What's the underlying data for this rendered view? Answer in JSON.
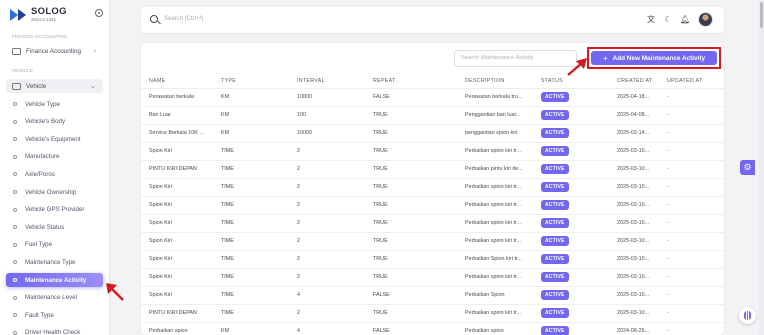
{
  "brand": {
    "name": "SOLOG",
    "version": "2024.8.1441"
  },
  "sidebar": {
    "section_top": "FINANCE ACCOUNTING",
    "finance": "Finance Accounting",
    "section_vehicle": "VEHICLE",
    "vehicle": "Vehicle",
    "items": [
      "Vehicle Type",
      "Vehicle's Body",
      "Vehicle's Equipment",
      "Manufacture",
      "Axle/Poros",
      "Vehicle Ownership",
      "Vehicle GPS Provider",
      "Vehicle Status",
      "Fuel Type",
      "Maintenance Type",
      "Maintenance Activity",
      "Maintenance Level",
      "Fault Type",
      "Driver Health Check"
    ],
    "active_index": 10
  },
  "topbar": {
    "search_placeholder": "Search (Ctrl+/)"
  },
  "toolbar": {
    "search_placeholder": "Search Maintenance Activity",
    "add_label": "Add New Maintenance Activity",
    "add_plus": "+"
  },
  "table": {
    "columns": [
      "NAME",
      "TYPE",
      "INTERVAL",
      "REPEAT",
      "DESCRIPTION",
      "STATUS",
      "CREATED AT",
      "UPDATED AT"
    ],
    "rows": [
      [
        "Perawatan berkala",
        "KM",
        "10000",
        "FALSE",
        "Perawatan berkala tru...",
        "ACTIVE",
        "2025-04-18...",
        "-"
      ],
      [
        "Ban Luar",
        "KM",
        "100",
        "TRUE",
        "Penggantian ban luar...",
        "ACTIVE",
        "2025-04-08...",
        "-"
      ],
      [
        "Service Berkala 10K ...",
        "KM",
        "10000",
        "TRUE",
        "penggantian spion kiri",
        "ACTIVE",
        "2025-03-14...",
        "-"
      ],
      [
        "Spion Kiri",
        "TIME",
        "2",
        "TRUE",
        "Perbaikan spion kiri tr...",
        "ACTIVE",
        "2025-03-10...",
        "-"
      ],
      [
        "PINTU KIRI DEPAN",
        "TIME",
        "2",
        "TRUE",
        "Perbaikan pintu kiri de...",
        "ACTIVE",
        "2025-03-10...",
        "-"
      ],
      [
        "Spion Kiri",
        "TIME",
        "2",
        "TRUE",
        "Perbaikan spion kiri tr...",
        "ACTIVE",
        "2025-03-10...",
        "-"
      ],
      [
        "Spion Kiri",
        "TIME",
        "2",
        "TRUE",
        "Perbaikan spion kiri tr...",
        "ACTIVE",
        "2025-03-10...",
        "-"
      ],
      [
        "Spion Kiri",
        "TIME",
        "2",
        "TRUE",
        "Perbaikan spion kiri tr...",
        "ACTIVE",
        "2025-03-10...",
        "-"
      ],
      [
        "Spion Kiri",
        "TIME",
        "2",
        "TRUE",
        "Perbaikan spion kiri tr...",
        "ACTIVE",
        "2025-03-10...",
        "-"
      ],
      [
        "Spion Kiri",
        "TIME",
        "2",
        "TRUE",
        "Perbaikan Spion kiri tr...",
        "ACTIVE",
        "2025-03-10...",
        "-"
      ],
      [
        "Spion Kiri",
        "TIME",
        "2",
        "TRUE",
        "Perbaikan spion kiri tr...",
        "ACTIVE",
        "2025-03-10...",
        "-"
      ],
      [
        "Spion Kiri",
        "TIME",
        "4",
        "FALSE",
        "Perbaikan Spion",
        "ACTIVE",
        "2025-03-10...",
        "-"
      ],
      [
        "PINTU KIRI DEPAN",
        "TIME",
        "2",
        "TRUE",
        "Perbaikan spion kiri tr...",
        "ACTIVE",
        "2025-03-10...",
        "-"
      ],
      [
        "Perbaikan spion",
        "KM",
        "4",
        "FALSE",
        "Perbaikan spion",
        "ACTIVE",
        "2024-08-26...",
        "-"
      ]
    ]
  },
  "colors": {
    "accent": "#7367f0",
    "highlight": "#d71920"
  },
  "icons": [
    "search-icon",
    "translate-icon",
    "theme-moon-icon",
    "notification-bell-icon",
    "settings-gear-icon",
    "help-icon"
  ]
}
